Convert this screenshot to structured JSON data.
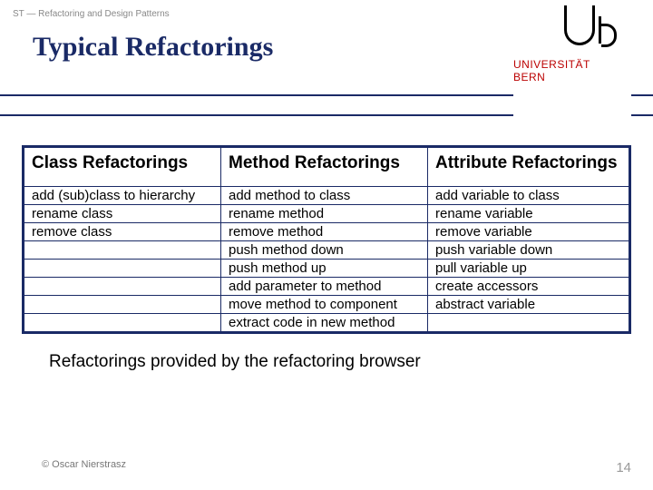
{
  "header": {
    "breadcrumb": "ST — Refactoring and Design Patterns"
  },
  "title": "Typical Refactorings",
  "logo": {
    "line1": "UNIVERSITÄT",
    "line2": "BERN"
  },
  "table": {
    "headers": [
      "Class Refactorings",
      "Method Refactorings",
      "Attribute Refactorings"
    ],
    "rows": [
      [
        "add (sub)class to hierarchy",
        "add method to class",
        "add variable to class"
      ],
      [
        "rename class",
        "rename method",
        "rename variable"
      ],
      [
        "remove class",
        "remove method",
        "remove variable"
      ],
      [
        "",
        "push method down",
        "push variable down"
      ],
      [
        "",
        "push method up",
        "pull variable up"
      ],
      [
        "",
        "add parameter to method",
        "create accessors"
      ],
      [
        "",
        "move method to component",
        "abstract variable"
      ],
      [
        "",
        "extract code in new method",
        ""
      ]
    ]
  },
  "caption": "Refactorings provided by the refactoring browser",
  "footer": {
    "copyright": "© Oscar Nierstrasz",
    "page": "14"
  }
}
